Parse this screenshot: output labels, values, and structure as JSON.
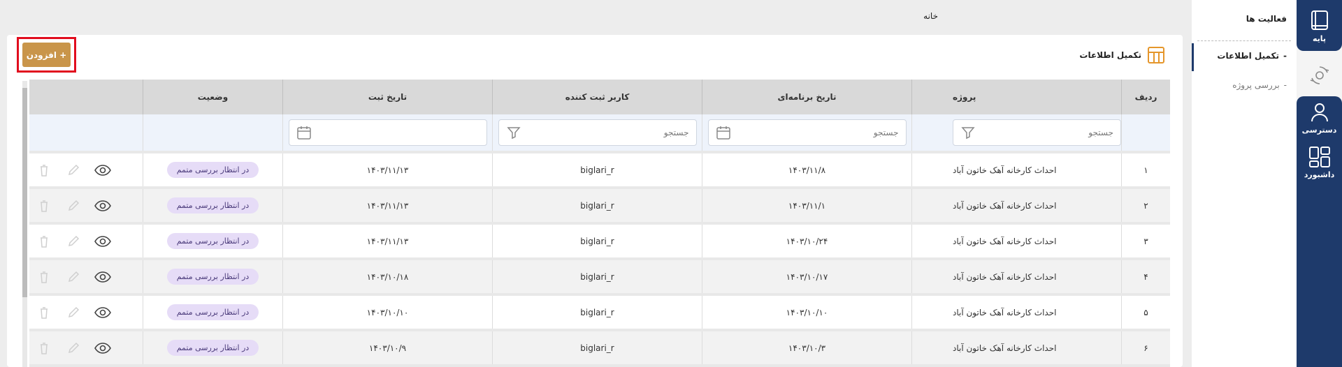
{
  "rail": {
    "top_label": "پایه",
    "access_label": "دسترسی",
    "dashboard_label": "داشبورد"
  },
  "side": {
    "heading": "فعالیت ها",
    "items": [
      {
        "label": "تکمیل اطلاعات",
        "active": true
      },
      {
        "label": "بررسی پروژه",
        "active": false
      }
    ]
  },
  "breadcrumb": "خانه",
  "card": {
    "title": "تکمیل اطلاعات",
    "add_button": "+ افزودن"
  },
  "table": {
    "headers": [
      "ردیف",
      "پروژه",
      "تاریخ برنامه‌ای",
      "کاربر ثبت کننده",
      "تاریخ ثبت",
      "وضعیت",
      ""
    ],
    "filter_placeholder": "جستجو",
    "rows": [
      {
        "n": "۱",
        "project": "احداث کارخانه آهک خاتون آباد",
        "planned": "۱۴۰۳/۱۱/۸",
        "user": "biglari_r",
        "registered": "۱۴۰۳/۱۱/۱۳",
        "status": "در انتظار بررسی متمم"
      },
      {
        "n": "۲",
        "project": "احداث کارخانه آهک خاتون آباد",
        "planned": "۱۴۰۳/۱۱/۱",
        "user": "biglari_r",
        "registered": "۱۴۰۳/۱۱/۱۳",
        "status": "در انتظار بررسی متمم"
      },
      {
        "n": "۳",
        "project": "احداث کارخانه آهک خاتون آباد",
        "planned": "۱۴۰۳/۱۰/۲۴",
        "user": "biglari_r",
        "registered": "۱۴۰۳/۱۱/۱۳",
        "status": "در انتظار بررسی متمم"
      },
      {
        "n": "۴",
        "project": "احداث کارخانه آهک خاتون آباد",
        "planned": "۱۴۰۳/۱۰/۱۷",
        "user": "biglari_r",
        "registered": "۱۴۰۳/۱۰/۱۸",
        "status": "در انتظار بررسی متمم"
      },
      {
        "n": "۵",
        "project": "احداث کارخانه آهک خاتون آباد",
        "planned": "۱۴۰۳/۱۰/۱۰",
        "user": "biglari_r",
        "registered": "۱۴۰۳/۱۰/۱۰",
        "status": "در انتظار بررسی متمم"
      },
      {
        "n": "۶",
        "project": "احداث کارخانه آهک خاتون آباد",
        "planned": "۱۴۰۳/۱۰/۳",
        "user": "biglari_r",
        "registered": "۱۴۰۳/۱۰/۹",
        "status": "در انتظار بررسی متمم"
      }
    ]
  },
  "colors": {
    "primary": "#1e3a6b",
    "accent_button": "#c9954a",
    "highlight_border": "#e10d1e",
    "badge_bg": "#e6dcf7",
    "title_icon": "#e5962b"
  }
}
